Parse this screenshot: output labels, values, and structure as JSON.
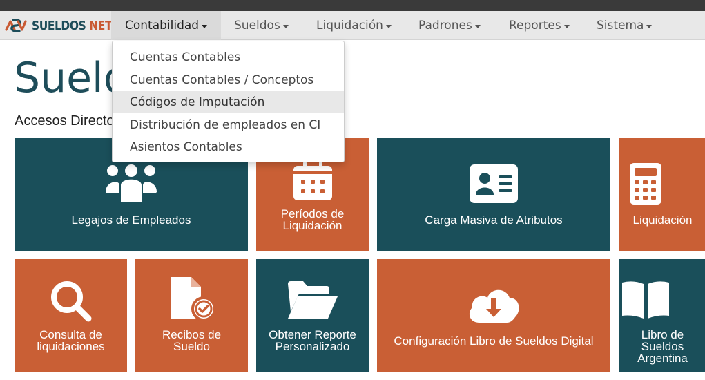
{
  "brand": {
    "part1": "SUELDOS",
    "part2": "NET"
  },
  "colors": {
    "teal": "#1a4f5a",
    "orange": "#c95f35",
    "title": "#1e4d5a"
  },
  "menu": [
    {
      "label": "Contabilidad",
      "active": true
    },
    {
      "label": "Sueldos"
    },
    {
      "label": "Liquidación"
    },
    {
      "label": "Padrones"
    },
    {
      "label": "Reportes"
    },
    {
      "label": "Sistema"
    }
  ],
  "dropdown": {
    "items": [
      {
        "label": "Cuentas Contables"
      },
      {
        "label": "Cuentas Contables / Conceptos"
      },
      {
        "label": "Códigos de Imputación",
        "highlighted": true
      },
      {
        "label": "Distribución de empleados en CI"
      },
      {
        "label": "Asientos Contables"
      }
    ]
  },
  "page": {
    "title": "Sueldos",
    "section": "Accesos Directos"
  },
  "tiles": [
    {
      "label": "Legajos de Empleados",
      "icon": "users-icon",
      "color": "teal"
    },
    {
      "label": "Períodos de\nLiquidación",
      "icon": "calendar-icon",
      "color": "orange"
    },
    {
      "label": "Carga Masiva de Atributos",
      "icon": "id-card-icon",
      "color": "teal"
    },
    {
      "label": "Liquidación",
      "icon": "calculator-icon",
      "color": "orange"
    },
    {
      "label": "Consulta de\nliquidaciones",
      "icon": "search-icon",
      "color": "orange"
    },
    {
      "label": "Recibos de\nSueldo",
      "icon": "file-check-icon",
      "color": "orange"
    },
    {
      "label": "Obtener Reporte\nPersonalizado",
      "icon": "folder-open-icon",
      "color": "teal"
    },
    {
      "label": "Configuración Libro de Sueldos Digital",
      "icon": "cloud-download-icon",
      "color": "orange"
    },
    {
      "label": "Libro de Sueldos\nArgentina",
      "icon": "book-open-icon",
      "color": "teal"
    }
  ]
}
